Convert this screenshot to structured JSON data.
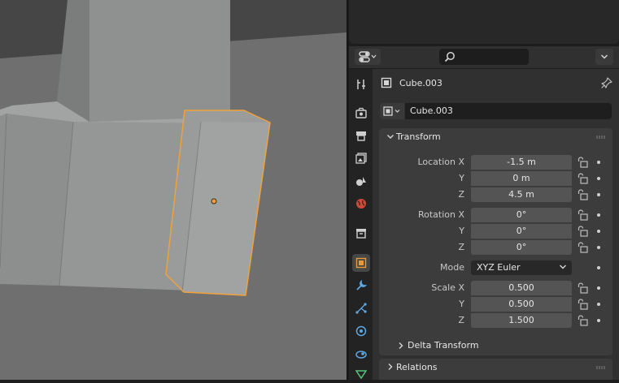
{
  "object": {
    "name": "Cube.003",
    "data_name": "Cube.003"
  },
  "search": {
    "placeholder": ""
  },
  "tabs": [
    {
      "name": "tool-icon"
    },
    {
      "name": "render-icon"
    },
    {
      "name": "output-icon"
    },
    {
      "name": "view-layer-icon"
    },
    {
      "name": "scene-icon"
    },
    {
      "name": "world-icon"
    },
    {
      "name": "collection-icon"
    },
    {
      "name": "object-icon",
      "active": true
    },
    {
      "name": "modifier-icon"
    },
    {
      "name": "particles-icon"
    },
    {
      "name": "physics-icon"
    },
    {
      "name": "constraints-icon"
    },
    {
      "name": "data-icon"
    }
  ],
  "transform": {
    "title": "Transform",
    "location": {
      "label_x": "Location X",
      "label_y": "Y",
      "label_z": "Z",
      "x": "-1.5 m",
      "y": "0 m",
      "z": "4.5 m"
    },
    "rotation": {
      "label_x": "Rotation X",
      "label_y": "Y",
      "label_z": "Z",
      "x": "0°",
      "y": "0°",
      "z": "0°"
    },
    "mode": {
      "label": "Mode",
      "value": "XYZ Euler"
    },
    "scale": {
      "label_x": "Scale X",
      "label_y": "Y",
      "label_z": "Z",
      "x": "0.500",
      "y": "0.500",
      "z": "1.500"
    },
    "delta_title": "Delta Transform"
  },
  "relations": {
    "title": "Relations"
  },
  "colors": {
    "accent": "#e69b39",
    "selection_outline": "#f0a23a",
    "object_origin": "#f0a23a"
  }
}
